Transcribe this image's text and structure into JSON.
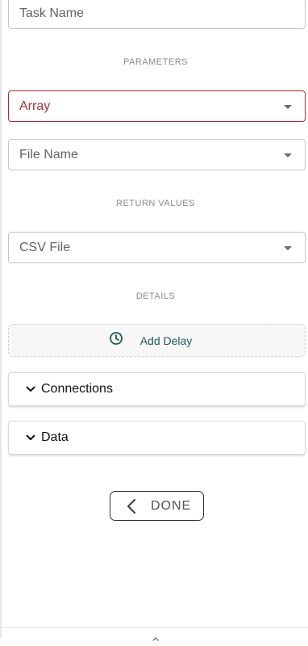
{
  "task_name": {
    "value": "Task Name"
  },
  "sections": {
    "parameters": "PARAMETERS",
    "return_values": "RETURN VALUES",
    "details": "DETAILS"
  },
  "parameters": {
    "array_select": "Array",
    "file_name_select": "File Name"
  },
  "return_values": {
    "csv_select": "CSV File"
  },
  "details": {
    "add_delay_label": "Add Delay"
  },
  "accordions": [
    {
      "title": "Connections"
    },
    {
      "title": "Data"
    }
  ],
  "footer": {
    "done_label": "DONE"
  },
  "colors": {
    "error_border": "#b3262b",
    "accent_teal": "#1e5a55"
  },
  "icons": {
    "clock": "clock-icon",
    "chevron": "chevron-down-icon",
    "back": "chevron-left-icon",
    "caret": "caret-down-icon",
    "handle": "chevron-up-icon"
  }
}
